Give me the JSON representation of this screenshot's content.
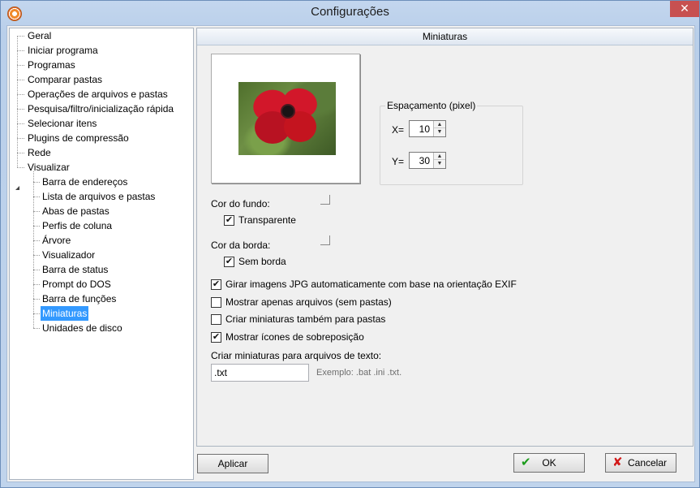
{
  "window": {
    "title": "Configurações",
    "close_glyph": "✕"
  },
  "tree": {
    "items": [
      {
        "label": "Geral",
        "level": 0
      },
      {
        "label": "Iniciar programa",
        "level": 0
      },
      {
        "label": "Programas",
        "level": 0
      },
      {
        "label": "Comparar pastas",
        "level": 0
      },
      {
        "label": "Operações de arquivos e pastas",
        "level": 0
      },
      {
        "label": "Pesquisa/filtro/inicialização rápida",
        "level": 0
      },
      {
        "label": "Selecionar itens",
        "level": 0
      },
      {
        "label": "Plugins de compressão",
        "level": 0
      },
      {
        "label": "Rede",
        "level": 0
      },
      {
        "label": "Visualizar",
        "level": 0,
        "expanded": true
      },
      {
        "label": "Barra de endereços",
        "level": 1
      },
      {
        "label": "Lista de arquivos e pastas",
        "level": 1
      },
      {
        "label": "Abas de pastas",
        "level": 1
      },
      {
        "label": "Perfis de coluna",
        "level": 1
      },
      {
        "label": "Árvore",
        "level": 1
      },
      {
        "label": "Visualizador",
        "level": 1
      },
      {
        "label": "Barra de status",
        "level": 1
      },
      {
        "label": "Prompt do DOS",
        "level": 1
      },
      {
        "label": "Barra de funções",
        "level": 1
      },
      {
        "label": "Miniaturas",
        "level": 1,
        "selected": true
      },
      {
        "label": "Unidades de disco",
        "level": 1
      }
    ]
  },
  "panel": {
    "header": "Miniaturas",
    "spacing": {
      "legend": "Espaçamento (pixel)",
      "x_label": "X=",
      "x_value": "10",
      "y_label": "Y=",
      "y_value": "30"
    },
    "background_color_label": "Cor do fundo:",
    "transparent_label": "Transparente",
    "transparent_checked": true,
    "border_color_label": "Cor da borda:",
    "no_border_label": "Sem borda",
    "no_border_checked": true,
    "options": [
      {
        "label": "Girar imagens JPG automaticamente com base na orientação EXIF",
        "checked": true
      },
      {
        "label": "Mostrar apenas arquivos (sem pastas)",
        "checked": false
      },
      {
        "label": "Criar miniaturas também para pastas",
        "checked": false
      },
      {
        "label": "Mostrar ícones de sobreposição",
        "checked": true
      }
    ],
    "text_thumbs_label": "Criar miniaturas para arquivos de texto:",
    "text_thumbs_value": ".txt",
    "text_thumbs_hint": "Exemplo: .bat .ini .txt."
  },
  "buttons": {
    "apply": "Aplicar",
    "ok": "OK",
    "cancel": "Cancelar"
  },
  "icons": {
    "check_glyph": "✔",
    "ok_glyph": "✔",
    "cancel_glyph": "✘",
    "up_glyph": "▲",
    "down_glyph": "▼"
  },
  "colors": {
    "selection": "#3399ff",
    "title_close": "#c75050"
  }
}
